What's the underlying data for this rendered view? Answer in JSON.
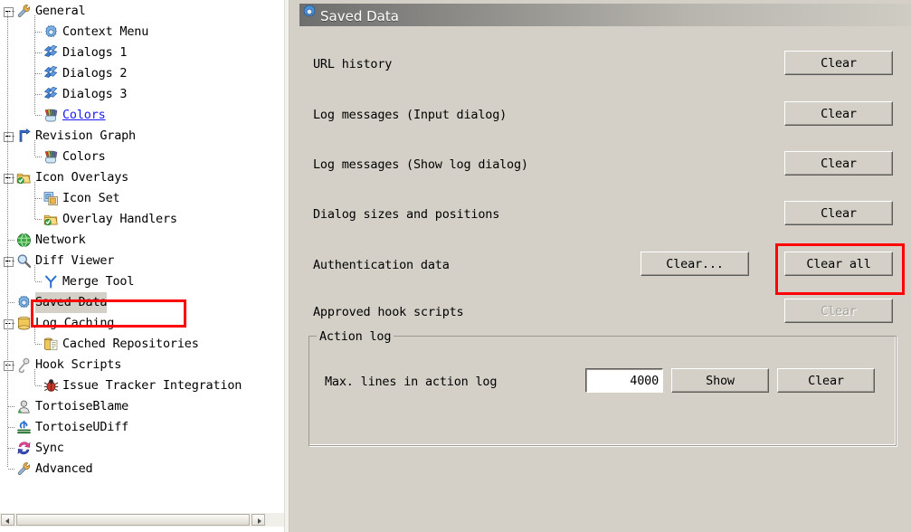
{
  "window": {
    "app": "TortoiseSVN Settings"
  },
  "tree": {
    "name": "settings-tree",
    "items": [
      {
        "label": "General",
        "icon": "wrench-icon",
        "depth": 0,
        "expander": "collapse",
        "state": "normal"
      },
      {
        "label": "Context Menu",
        "icon": "gear-blue-icon",
        "depth": 1,
        "expander": "none",
        "state": "normal"
      },
      {
        "label": "Dialogs 1",
        "icon": "dialogs-icon",
        "depth": 1,
        "expander": "none",
        "state": "normal"
      },
      {
        "label": "Dialogs 2",
        "icon": "dialogs-icon",
        "depth": 1,
        "expander": "none",
        "state": "normal"
      },
      {
        "label": "Dialogs 3",
        "icon": "dialogs-icon",
        "depth": 1,
        "expander": "none",
        "state": "normal"
      },
      {
        "label": "Colors",
        "icon": "palette-icon",
        "depth": 1,
        "expander": "none",
        "state": "link"
      },
      {
        "label": "Revision Graph",
        "icon": "revision-graph-icon",
        "depth": 0,
        "expander": "collapse",
        "state": "normal"
      },
      {
        "label": "Colors",
        "icon": "palette-icon",
        "depth": 1,
        "expander": "none",
        "state": "normal"
      },
      {
        "label": "Icon Overlays",
        "icon": "folder-check-icon",
        "depth": 0,
        "expander": "collapse",
        "state": "normal"
      },
      {
        "label": "Icon Set",
        "icon": "icon-set-icon",
        "depth": 1,
        "expander": "none",
        "state": "normal"
      },
      {
        "label": "Overlay Handlers",
        "icon": "folder-check-icon",
        "depth": 1,
        "expander": "none",
        "state": "normal"
      },
      {
        "label": "Network",
        "icon": "globe-icon",
        "depth": 0,
        "expander": "none",
        "state": "normal"
      },
      {
        "label": "Diff Viewer",
        "icon": "magnifier-icon",
        "depth": 0,
        "expander": "collapse",
        "state": "normal"
      },
      {
        "label": "Merge Tool",
        "icon": "merge-icon",
        "depth": 1,
        "expander": "none",
        "state": "normal"
      },
      {
        "label": "Saved Data",
        "icon": "gear-blue-icon",
        "depth": 0,
        "expander": "none",
        "state": "selected"
      },
      {
        "label": "Log Caching",
        "icon": "database-icon",
        "depth": 0,
        "expander": "collapse",
        "state": "normal"
      },
      {
        "label": "Cached Repositories",
        "icon": "cached-repo-icon",
        "depth": 1,
        "expander": "none",
        "state": "normal"
      },
      {
        "label": "Hook Scripts",
        "icon": "hook-icon",
        "depth": 0,
        "expander": "collapse",
        "state": "normal"
      },
      {
        "label": "Issue Tracker Integration",
        "icon": "bug-icon",
        "depth": 1,
        "expander": "none",
        "state": "normal"
      },
      {
        "label": "TortoiseBlame",
        "icon": "blame-icon",
        "depth": 0,
        "expander": "none",
        "state": "normal"
      },
      {
        "label": "TortoiseUDiff",
        "icon": "udiff-icon",
        "depth": 0,
        "expander": "none",
        "state": "normal"
      },
      {
        "label": "Sync",
        "icon": "sync-icon",
        "depth": 0,
        "expander": "none",
        "state": "normal"
      },
      {
        "label": "Advanced",
        "icon": "wrench-icon",
        "depth": 0,
        "expander": "none",
        "state": "normal"
      }
    ]
  },
  "page": {
    "title": "Saved Data",
    "title_icon": "gear-blue-icon",
    "rows": [
      {
        "label": "URL history",
        "buttons": [
          {
            "text": "Clear",
            "enabled": true
          }
        ]
      },
      {
        "label": "Log messages (Input dialog)",
        "buttons": [
          {
            "text": "Clear",
            "enabled": true
          }
        ]
      },
      {
        "label": "Log messages (Show log dialog)",
        "buttons": [
          {
            "text": "Clear",
            "enabled": true
          }
        ]
      },
      {
        "label": "Dialog sizes and positions",
        "buttons": [
          {
            "text": "Clear",
            "enabled": true
          }
        ]
      },
      {
        "label": "Authentication data",
        "buttons": [
          {
            "text": "Clear...",
            "enabled": true
          },
          {
            "text": "Clear all",
            "enabled": true
          }
        ]
      },
      {
        "label": "Approved hook scripts",
        "buttons": [
          {
            "text": "Clear",
            "enabled": false
          }
        ]
      }
    ],
    "action_log": {
      "group_title": "Action log",
      "max_lines_label": "Max. lines in action log",
      "max_lines_value": "4000",
      "show_button": "Show",
      "clear_button": "Clear"
    }
  },
  "annotations": {
    "highlight_color": "#ff0000",
    "boxes": [
      {
        "target": "sidebar-item-saved-data"
      },
      {
        "target": "clear-all-button"
      }
    ]
  }
}
